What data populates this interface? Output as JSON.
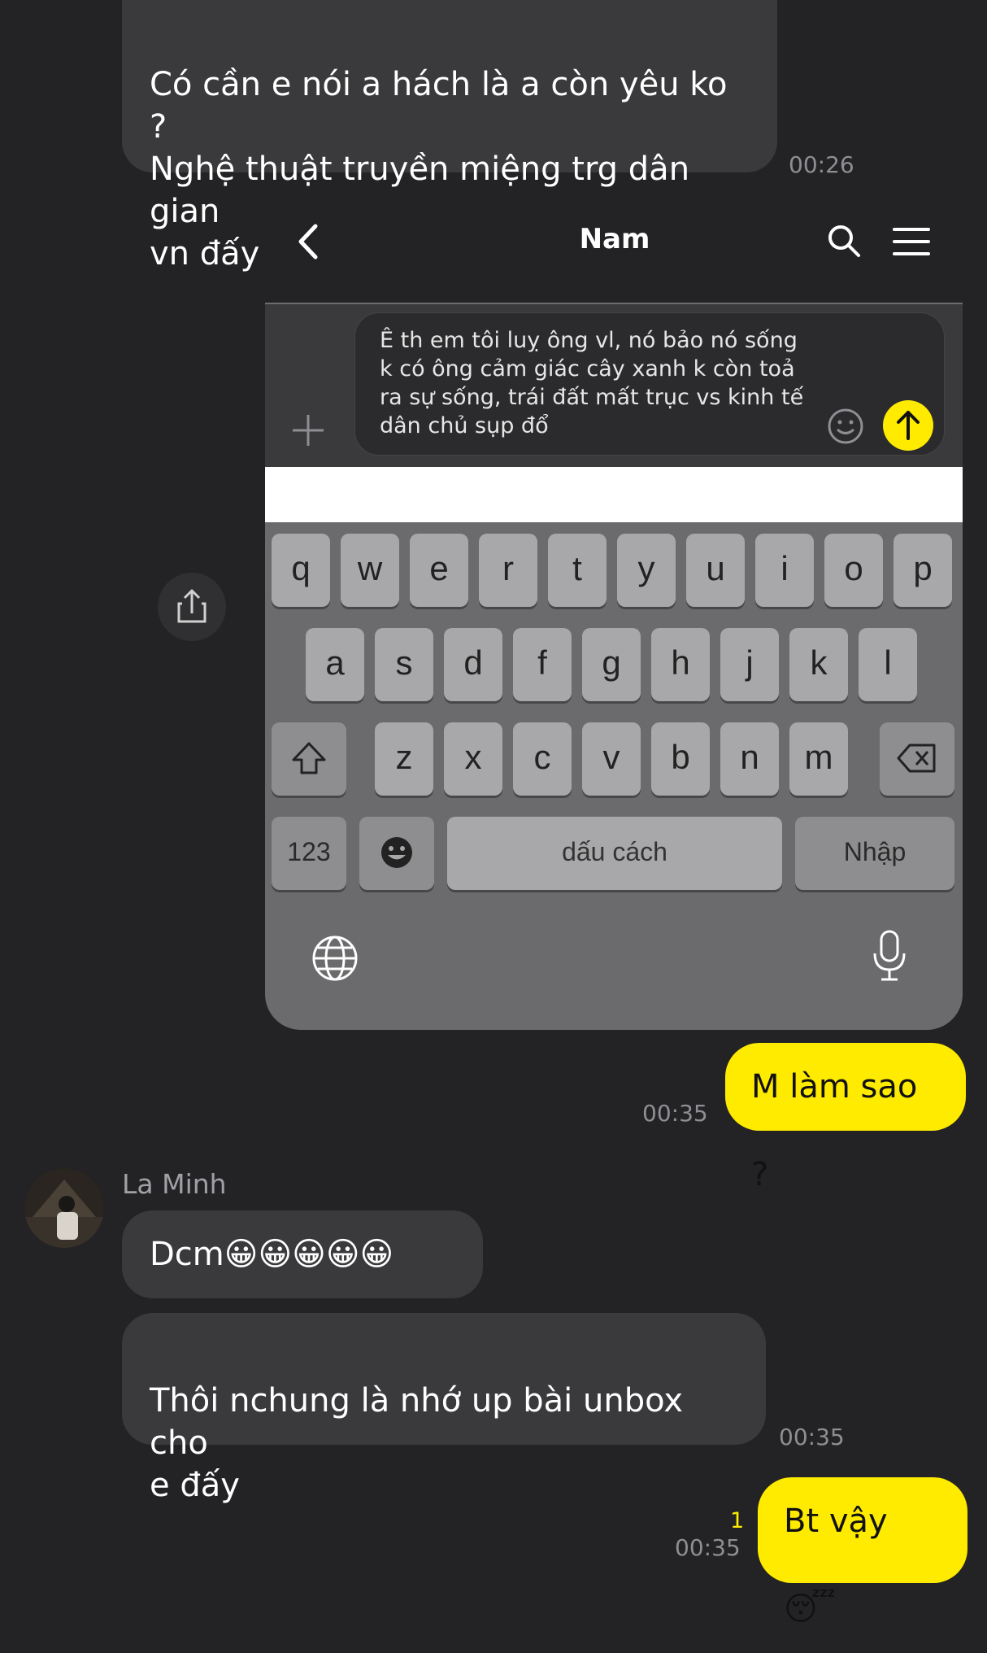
{
  "messages": {
    "m1": {
      "text": "Có cần e nói a hách là a còn yêu ko ?\nNghệ thuật truyền miệng trg dân gian\nvn đấy",
      "time": "00:26"
    },
    "m2": {
      "text": "M làm sao ?",
      "time": "00:35"
    },
    "m3": {
      "sender": "La Minh",
      "text": "Dcm😀😀😀😀😀"
    },
    "m4": {
      "text": "Thôi nchung là nhớ up bài unbox cho\ne đấy",
      "time": "00:35"
    },
    "m5": {
      "text": "Bt vậy 😴",
      "unread": "1",
      "time": "00:35"
    }
  },
  "shot": {
    "title": "Nam",
    "input_text": "Ê th em tôi luỵ ông vl, nó bảo nó sống\nk có ông cảm giác cây xanh k còn toả\nra sự sống, trái đất mất trục vs kinh tế\ndân chủ sụp đổ",
    "keyboard": {
      "row1": [
        "q",
        "w",
        "e",
        "r",
        "t",
        "y",
        "u",
        "i",
        "o",
        "p"
      ],
      "row2": [
        "a",
        "s",
        "d",
        "f",
        "g",
        "h",
        "j",
        "k",
        "l"
      ],
      "row3": [
        "z",
        "x",
        "c",
        "v",
        "b",
        "n",
        "m"
      ],
      "numbers_label": "123",
      "space_label": "dấu cách",
      "enter_label": "Nhập"
    }
  },
  "colors": {
    "accent": "#ffeb00",
    "background": "#232325",
    "bubble_in": "#3a3a3c"
  },
  "icons": [
    "back-chevron-icon",
    "search-icon",
    "menu-icon",
    "plus-icon",
    "emoji-icon",
    "send-arrow-icon",
    "share-icon",
    "shift-icon",
    "backspace-icon",
    "emoji-key-icon",
    "globe-icon",
    "microphone-icon"
  ]
}
